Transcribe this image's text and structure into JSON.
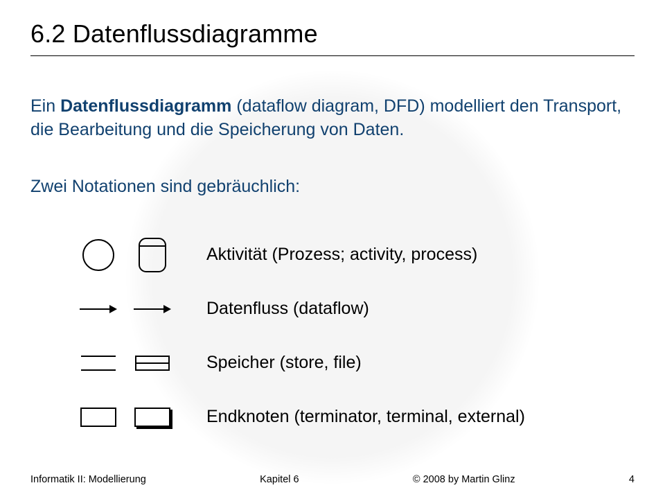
{
  "title": "6.2   Datenflussdiagramme",
  "para1": {
    "prefix": "Ein ",
    "term": "Datenflussdiagramm",
    "rest": " (dataflow diagram, DFD) modelliert den Transport, die Bearbeitung und die Speicherung von Daten."
  },
  "para2": "Zwei Notationen sind gebräuchlich:",
  "notation_labels": {
    "activity": "Aktivität (Prozess; activity, process)",
    "dataflow": "Datenfluss (dataflow)",
    "store": "Speicher (store, file)",
    "terminator": "Endknoten (terminator, terminal, external)"
  },
  "footer": {
    "left": "Informatik II: Modellierung",
    "center": "Kapitel 6",
    "right": "© 2008 by Martin Glinz",
    "page": "4"
  }
}
